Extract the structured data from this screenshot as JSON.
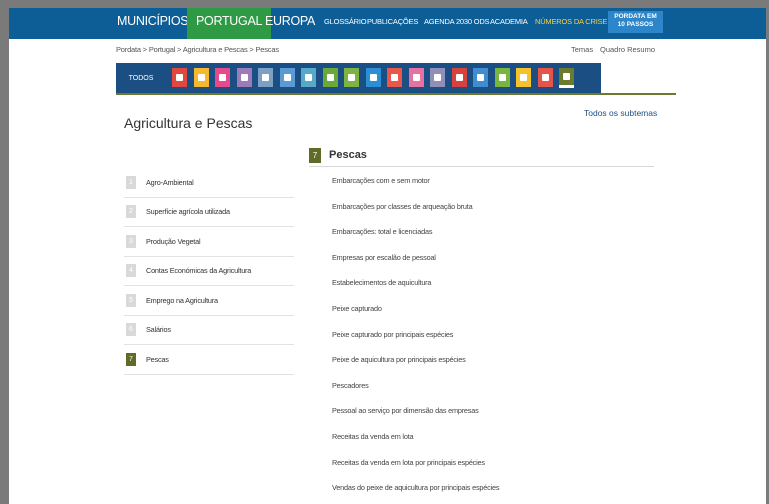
{
  "nav": {
    "municipios": "MUNICÍPIOS",
    "portugal": "PORTUGAL",
    "europa": "EUROPA",
    "glossario": "GLOSSÁRIO",
    "publicacoes": "PUBLICAÇÕES",
    "agenda": "AGENDA 2030 ODS",
    "academia": "ACADEMIA",
    "crise": "NÚMEROS DA CRISE",
    "passos_top": "PORDATA EM",
    "passos_bottom": "10 PASSOS"
  },
  "breadcrumb": [
    "Pordata",
    "Portugal",
    "Agricultura e Pescas",
    "Pescas"
  ],
  "breadcrumb_sep": " > ",
  "right_links": {
    "temas": "Temas",
    "quadro": "Quadro Resumo"
  },
  "themebar": {
    "todos": "TODOS",
    "icons": [
      {
        "name": "population-icon",
        "color": "#e0473e"
      },
      {
        "name": "education-icon",
        "color": "#f5b82e"
      },
      {
        "name": "health-icon",
        "color": "#e64a8c"
      },
      {
        "name": "social-icon",
        "color": "#9b7bb8"
      },
      {
        "name": "housing-icon",
        "color": "#7c9fc5"
      },
      {
        "name": "justice-icon",
        "color": "#5b9bd5"
      },
      {
        "name": "employment-icon",
        "color": "#58a9c9"
      },
      {
        "name": "agriculture-icon",
        "color": "#6aa83a"
      },
      {
        "name": "environment-icon",
        "color": "#7cb342"
      },
      {
        "name": "culture-icon",
        "color": "#2a8fd4"
      },
      {
        "name": "economy-icon",
        "color": "#e8584a"
      },
      {
        "name": "tourism-icon",
        "color": "#e672a2"
      },
      {
        "name": "state-icon",
        "color": "#8f8fb8"
      },
      {
        "name": "science-icon",
        "color": "#d6433f"
      },
      {
        "name": "industry-icon",
        "color": "#3f8cd0"
      },
      {
        "name": "territory-icon",
        "color": "#78b640"
      },
      {
        "name": "energy-icon",
        "color": "#f4c22b"
      },
      {
        "name": "transport-icon",
        "color": "#e6534a"
      },
      {
        "name": "fisheries-icon",
        "color": "#6b7a2e"
      }
    ]
  },
  "section_title": "Agricultura e Pescas",
  "all_subtopics": "Todos os subtemas",
  "left_list": [
    {
      "num": "1",
      "label": "Agro-Ambiental"
    },
    {
      "num": "2",
      "label": "Superfície agrícola utilizada"
    },
    {
      "num": "3",
      "label": "Produção Vegetal"
    },
    {
      "num": "4",
      "label": "Contas Económicas da Agricultura"
    },
    {
      "num": "5",
      "label": "Emprego na Agricultura"
    },
    {
      "num": "6",
      "label": "Salários"
    },
    {
      "num": "7",
      "label": "Pescas"
    }
  ],
  "right_header": {
    "num": "7",
    "title": "Pescas"
  },
  "right_list": [
    "Embarcações com e sem motor",
    "Embarcações por classes de arqueação bruta",
    "Embarcações: total e licenciadas",
    "Empresas por escalão de pessoal",
    "Estabelecimentos de aquicultura",
    "Peixe capturado",
    "Peixe capturado por principais espécies",
    "Peixe de aquicultura por principais espécies",
    "Pescadores",
    "Pessoal ao serviço por dimensão das empresas",
    "Receitas da venda em lota",
    "Receitas da venda em lota por principais espécies",
    "Vendas do peixe de aquicultura por principais espécies"
  ]
}
